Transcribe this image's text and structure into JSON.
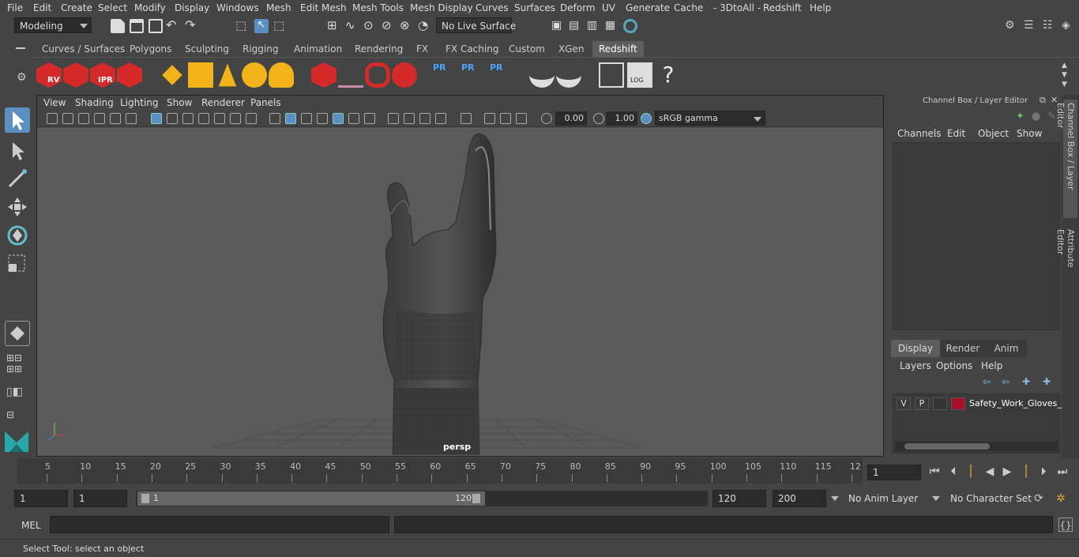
{
  "menu": [
    "File",
    "Edit",
    "Create",
    "Select",
    "Modify",
    "Display",
    "Windows",
    "Mesh",
    "Edit Mesh",
    "Mesh Tools",
    "Mesh Display",
    "Curves",
    "Surfaces",
    "Deform",
    "UV",
    "Generate",
    "Cache",
    "- 3DtoAll -",
    "Redshift",
    "Help"
  ],
  "status": {
    "mode": "Modeling",
    "live_surface": "No Live Surface"
  },
  "shelf_tabs": [
    "Curves / Surfaces",
    "Polygons",
    "Sculpting",
    "Rigging",
    "Animation",
    "Rendering",
    "FX",
    "FX Caching",
    "Custom",
    "XGen",
    "Redshift"
  ],
  "shelf_active": "Redshift",
  "shelf_labels": {
    "rv": "RV",
    "ipr": "IPR",
    "pr1": "PR",
    "pr2": "PR",
    "pr3": "PR",
    "log": "LOG",
    "help": "?"
  },
  "viewport": {
    "menu": [
      "View",
      "Shading",
      "Lighting",
      "Show",
      "Renderer",
      "Panels"
    ],
    "exposure": "0.00",
    "gamma": "1.00",
    "color_space": "sRGB gamma",
    "camera_label": "persp"
  },
  "channel_box": {
    "title": "Channel Box / Layer Editor",
    "menu": [
      "Channels",
      "Edit",
      "Object",
      "Show"
    ]
  },
  "layer_editor": {
    "tabs": [
      "Display",
      "Render",
      "Anim"
    ],
    "active_tab": "Display",
    "menu": [
      "Layers",
      "Options",
      "Help"
    ],
    "layers": [
      {
        "v": "V",
        "p": "P",
        "color": "#a8102a",
        "name": "Safety_Work_Gloves_S"
      }
    ]
  },
  "side_tabs": [
    "Channel Box / Layer Editor",
    "Attribute Editor"
  ],
  "timeline": {
    "ticks": [
      "5",
      "10",
      "15",
      "20",
      "25",
      "30",
      "35",
      "40",
      "45",
      "50",
      "55",
      "60",
      "65",
      "70",
      "75",
      "80",
      "85",
      "90",
      "95",
      "100",
      "105",
      "110",
      "115",
      "12"
    ],
    "start_label": "1",
    "current_frame": "1"
  },
  "range": {
    "start": "1",
    "playback_start": "1",
    "slider_start": "1",
    "slider_end": "120",
    "playback_end": "120",
    "end": "200",
    "anim_layer": "No Anim Layer",
    "char_set": "No Character Set"
  },
  "cmd": {
    "label": "MEL"
  },
  "help_text": "Select Tool: select an object"
}
